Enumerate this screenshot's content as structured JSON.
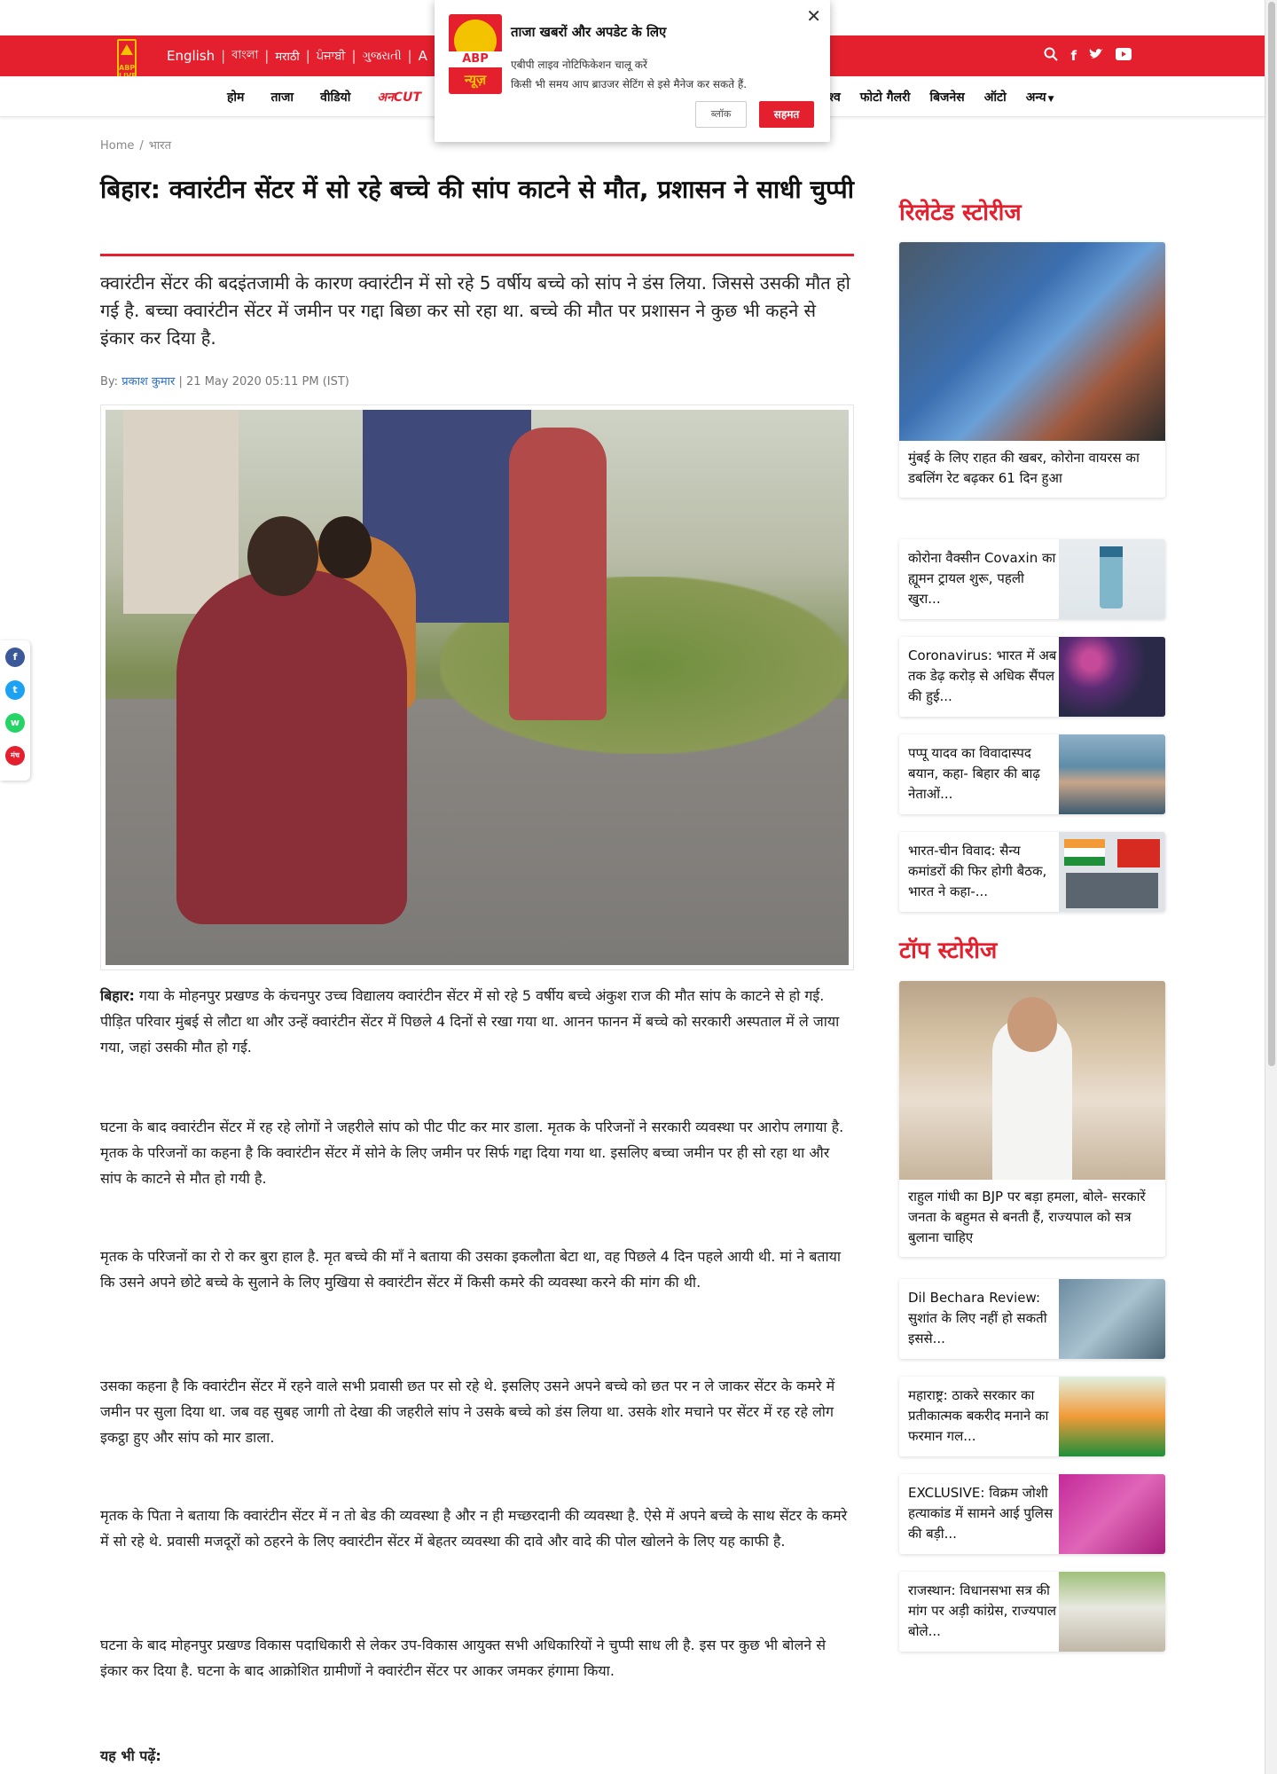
{
  "header": {
    "languages": [
      "English",
      "বাংলা",
      "मराठी",
      "ਪੰਜਾਬੀ",
      "ગુજરાતી",
      "A"
    ],
    "social": [
      "search-icon",
      "facebook-icon",
      "twitter-icon",
      "youtube-icon"
    ]
  },
  "logo": {
    "text": "ABP\nLIVE"
  },
  "nav": {
    "left": [
      "होम",
      "ताजा",
      "वीडियो",
      "अनCUT"
    ],
    "right": [
      "श्व",
      "फोटो गैलरी",
      "बिजनेस",
      "ऑटो",
      "अन्य"
    ]
  },
  "popup": {
    "title": "ताजा खबरों और अपडेट के लिए",
    "line1": "एबीपी लाइव नोटिफिकेशन चालू करें",
    "line2": "किसी भी समय आप ब्राउजर सेटिंग से इसे मैनेज कर सकते हैं.",
    "block": "ब्लॉक",
    "agree": "सहमत",
    "logo_abp": "ABP",
    "logo_news": "न्यूज़"
  },
  "breadcrumb": [
    "Home",
    "भारत"
  ],
  "article": {
    "headline": "बिहार: क्वारंटीन सेंटर में सो रहे बच्चे की सांप काटने से मौत, प्रशासन ने साधी चुप्पी",
    "summary": "क्वारंटीन सेंटर की बदइंतजामी के कारण क्वारंटीन में सो रहे 5 वर्षीय बच्चे को सांप ने डंस लिया. जिससे उसकी मौत हो गई है. बच्चा क्वारंटीन सेंटर में जमीन पर गद्दा बिछा कर सो रहा था. बच्चे की मौत पर प्रशासन ने कुछ भी कहने से इंकार कर दिया है.",
    "by_label": "By:",
    "author": "प्रकाश कुमार",
    "date": "21 May 2020 05:11 PM (IST)",
    "para1_lead": "बिहार:",
    "para1": " गया के मोहनपुर प्रखण्ड के कंचनपुर उच्च विद्यालय क्वारंटीन सेंटर में सो रहे 5 वर्षीय बच्चे अंकुश राज की मौत सांप के काटने से हो गई. पीड़ित परिवार मुंबई से लौटा था और उन्हें क्वारंटीन सेंटर में पिछले 4 दिनों से रखा गया था. आनन फानन में बच्चे को सरकारी अस्पताल में ले जाया गया, जहां उसकी मौत हो गई.",
    "para2": "घटना के बाद क्वारंटीन सेंटर में रह रहे लोगों ने जहरीले सांप को पीट पीट कर मार डाला. मृतक के परिजनों ने सरकारी व्यवस्था पर आरोप लगाया है. मृतक के परिजनों का कहना है कि क्वारंटीन सेंटर में सोने के लिए जमीन पर सिर्फ गद्दा दिया गया था. इसलिए बच्चा जमीन पर ही सो रहा था और सांप के काटने से मौत हो गयी है.",
    "para3": "मृतक के परिजनों का रो रो कर बुरा हाल है. मृत बच्चे की माँ ने बताया की उसका इकलौता बेटा था, वह पिछले 4 दिन पहले आयी थी. मां ने बताया कि उसने अपने छोटे बच्चे के सुलाने के लिए मुखिया से क्वारंटीन सेंटर में किसी कमरे की व्यवस्था करने की मांग की थी.",
    "para4": "उसका कहना है कि क्वारंटीन सेंटर में रहने वाले सभी प्रवासी छत पर सो रहे थे. इसलिए उसने अपने बच्चे को छत पर न ले जाकर सेंटर के कमरे में जमीन पर सुला दिया था. जब वह सुबह जागी तो देखा की जहरीले सांप ने उसके बच्चे को डंस लिया था. उसके शोर मचाने पर सेंटर में रह रहे लोग इकट्ठा हुए और सांप को मार डाला.",
    "para5": "मृतक के पिता ने बताया कि क्वारंटीन सेंटर में न तो बेड की व्यवस्था है और न ही मच्छरदानी की व्यवस्था है. ऐसे में अपने बच्चे के साथ सेंटर के कमरे में सो रहे थे. प्रवासी मजदूरों को ठहरने के लिए क्वारंटीन सेंटर में बेहतर व्यवस्था की दावे और वादे की पोल खोलने के लिए यह काफी है.",
    "para6": "घटना के बाद मोहनपुर प्रखण्ड विकास पदाधिकारी से लेकर उप-विकास आयुक्त सभी अधिकारियों ने चुप्पी साध ली है. इस पर कुछ भी बोलने से इंकार कर दिया है. घटना के बाद आक्रोशित ग्रामीणों ने क्वारंटीन सेंटर पर आकर जमकर हंगामा किया.",
    "also_read": "यह भी पढ़ें:"
  },
  "share": {
    "labels": [
      "f",
      "t",
      "w",
      "मंच"
    ],
    "colors": [
      "#3b5998",
      "#1da1f2",
      "#25d366",
      "#e4202e"
    ]
  },
  "related": {
    "heading": "रिलेटेड स्टोरीज",
    "big": "मुंबई के लिए राहत की खबर, कोरोना वायरस का डबलिंग रेट बढ़कर 61 दिन हुआ",
    "items": [
      "कोरोना वैक्सीन Covaxin का ह्यूमन ट्रायल शुरू, पहली खुरा...",
      "Coronavirus: भारत में अब तक डेढ़ करोड़ से अधिक सैंपल की हुई...",
      "पप्पू यादव का विवादास्पद बयान, कहा- बिहार की बाढ़ नेताओं...",
      "भारत-चीन विवाद: सैन्य कमांडरों की फिर होगी बैठक, भारत ने कहा-..."
    ]
  },
  "top": {
    "heading": "टॉप स्टोरीज",
    "big": "राहुल गांधी का BJP पर बड़ा हमला, बोले- सरकारें जनता के बहुमत से बनती हैं, राज्यपाल को सत्र बुलाना चाहिए",
    "items": [
      "Dil Bechara Review: सुशांत के लिए नहीं हो सकती इससे...",
      "महाराष्ट्र: ठाकरे सरकार का प्रतीकात्मक बकरीद मनाने का फरमान गल...",
      "EXCLUSIVE: विक्रम जोशी हत्याकांड में सामने आई पुलिस की बड़ी...",
      "राजस्थान: विधानसभा सत्र की मांग पर अड़ी कांग्रेस, राज्यपाल बोले..."
    ]
  }
}
